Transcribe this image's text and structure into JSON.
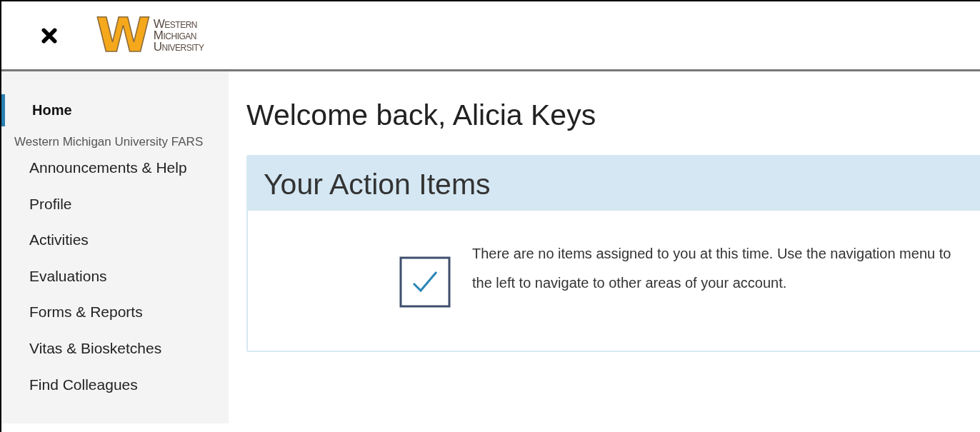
{
  "header": {
    "logo": {
      "letter": "W",
      "lines": [
        "Western",
        "Michigan",
        "University"
      ]
    }
  },
  "sidebar": {
    "home": {
      "label": "Home",
      "selected": true
    },
    "group": "Western Michigan University FARS",
    "items": [
      {
        "label": "Announcements & Help",
        "selected": false
      },
      {
        "label": "Profile",
        "selected": false
      },
      {
        "label": "Activities",
        "selected": false
      },
      {
        "label": "Evaluations",
        "selected": false
      },
      {
        "label": "Forms & Reports",
        "selected": false
      },
      {
        "label": "Vitas & Biosketches",
        "selected": false
      },
      {
        "label": "Find Colleagues",
        "selected": false
      }
    ]
  },
  "main": {
    "greeting": "Welcome back,  Alicia Keys",
    "panel": {
      "title": "Your Action Items",
      "message": "There are no items assigned to you at this time. Use the navigation menu to the left to navigate to other areas of your account."
    }
  }
}
